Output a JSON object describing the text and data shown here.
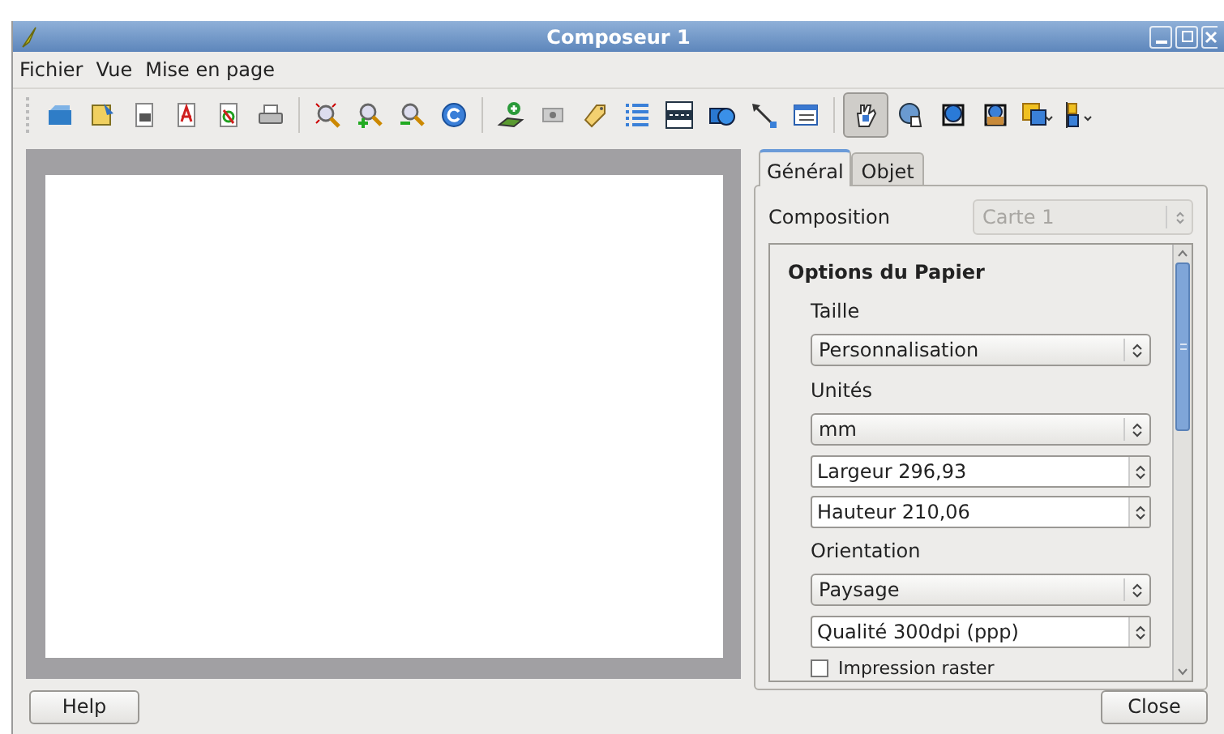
{
  "window": {
    "title": "Composeur 1"
  },
  "menu": [
    "Fichier",
    "Vue",
    "Mise en page"
  ],
  "toolbar": {
    "groups": [
      [
        {
          "selected": false
        },
        {
          "selected": false
        },
        {
          "selected": false
        },
        {
          "selected": false
        },
        {
          "selected": false
        },
        {
          "selected": false
        }
      ],
      [
        {
          "selected": false
        },
        {
          "selected": false
        },
        {
          "selected": false
        },
        {
          "selected": false
        }
      ],
      [
        {
          "selected": false
        },
        {
          "selected": false
        },
        {
          "selected": false
        },
        {
          "selected": false
        },
        {
          "selected": false
        },
        {
          "selected": false
        },
        {
          "selected": false
        },
        {
          "selected": false
        }
      ],
      [
        {
          "selected": true
        },
        {
          "selected": false
        },
        {
          "selected": false
        },
        {
          "selected": false
        },
        {
          "selected": false
        },
        {
          "selected": false
        }
      ]
    ]
  },
  "tabs": [
    {
      "label": "Général",
      "selected": true
    },
    {
      "label": "Objet",
      "selected": false
    }
  ],
  "composition": {
    "label": "Composition",
    "value": "Carte 1",
    "disabled": true
  },
  "section": {
    "title": "Options du Papier",
    "rows": [
      {
        "kind": "label",
        "text": "Taille"
      },
      {
        "kind": "select",
        "text": "Personnalisation"
      },
      {
        "kind": "label",
        "text": "Unités"
      },
      {
        "kind": "select",
        "text": "mm"
      },
      {
        "kind": "spin",
        "text": "Largeur 296,93"
      },
      {
        "kind": "spin",
        "text": "Hauteur 210,06"
      },
      {
        "kind": "label",
        "text": "Orientation"
      },
      {
        "kind": "select",
        "text": "Paysage"
      },
      {
        "kind": "spin",
        "text": "Qualité 300dpi (ppp)"
      },
      {
        "kind": "checkbox",
        "text": "Impression raster",
        "checked": false
      }
    ]
  },
  "buttons": {
    "help": "Help",
    "close": "Close"
  }
}
